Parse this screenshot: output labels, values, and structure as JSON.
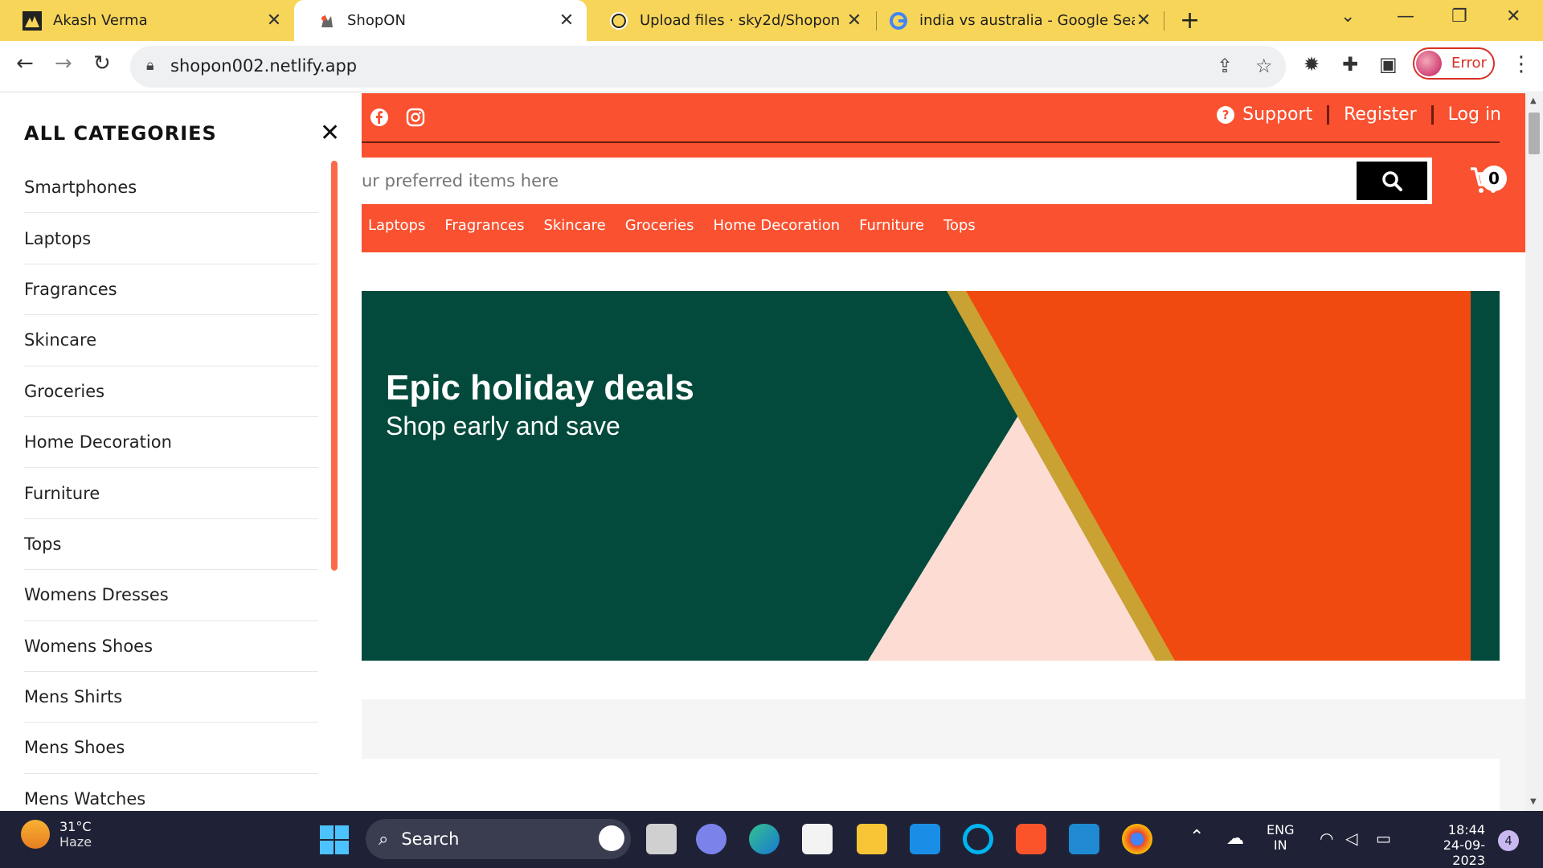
{
  "browser": {
    "tabs": [
      {
        "title": "Akash Verma",
        "favicon": "akash-favicon",
        "active": false
      },
      {
        "title": "ShopON",
        "favicon": "shopon-favicon",
        "active": true
      },
      {
        "title": "Upload files · sky2d/Shopon",
        "favicon": "github-icon",
        "active": false
      },
      {
        "title": "india vs australia - Google Search",
        "favicon": "google-icon",
        "active": false
      }
    ],
    "url": "shopon002.netlify.app",
    "profile_status": "Error",
    "tab_close": "✕",
    "new_tab": "+"
  },
  "header": {
    "links": {
      "support": "Support",
      "register": "Register",
      "login": "Log in"
    },
    "search_placeholder": "ur preferred items here",
    "cart_count": "0",
    "categories": [
      "Laptops",
      "Fragrances",
      "Skincare",
      "Groceries",
      "Home Decoration",
      "Furniture",
      "Tops"
    ]
  },
  "banner": {
    "title": "Epic holiday deals",
    "subtitle": "Shop early and save"
  },
  "sidebar": {
    "title": "ALL CATEGORIES",
    "close": "✕",
    "items": [
      "Smartphones",
      "Laptops",
      "Fragrances",
      "Skincare",
      "Groceries",
      "Home Decoration",
      "Furniture",
      "Tops",
      "Womens Dresses",
      "Womens Shoes",
      "Mens Shirts",
      "Mens Shoes",
      "Mens Watches"
    ]
  },
  "taskbar": {
    "temperature": "31°C",
    "weather": "Haze",
    "search": "Search",
    "lang": "ENG",
    "region": "IN",
    "time": "18:44",
    "date": "24-09-2023",
    "notifications": "4"
  },
  "colors": {
    "brand": "#fa5130",
    "banner_green": "#034a3c",
    "banner_orange": "#f04a10",
    "tab_bar": "#f7d558"
  }
}
